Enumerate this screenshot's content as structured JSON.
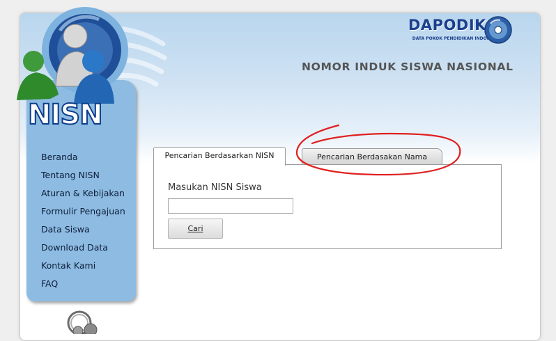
{
  "brand": {
    "logo_text": "NISN",
    "partner_logo_text": "DAPODIK",
    "partner_tagline": "DATA POKOK PENDIDIKAN INDONESIA",
    "site_title": "NOMOR INDUK SISWA NASIONAL"
  },
  "sidebar": {
    "items": [
      {
        "label": "Beranda"
      },
      {
        "label": "Tentang NISN"
      },
      {
        "label": "Aturan & Kebijakan"
      },
      {
        "label": "Formulir Pengajuan"
      },
      {
        "label": "Data Siswa"
      },
      {
        "label": "Download Data"
      },
      {
        "label": "Kontak Kami"
      },
      {
        "label": "FAQ"
      }
    ]
  },
  "tabs": [
    {
      "label": "Pencarian Berdasarkan NISN",
      "active": true
    },
    {
      "label": "Pencarian Berdasakan Nama",
      "active": false
    }
  ],
  "search": {
    "heading": "Masukan NISN Siswa",
    "input_value": "",
    "button_label": "Cari"
  },
  "colors": {
    "sidebar": "#8dbbe2",
    "header_gradient_top": "#b9d6ee",
    "title_text": "#555555",
    "annotation": "#e02020"
  }
}
